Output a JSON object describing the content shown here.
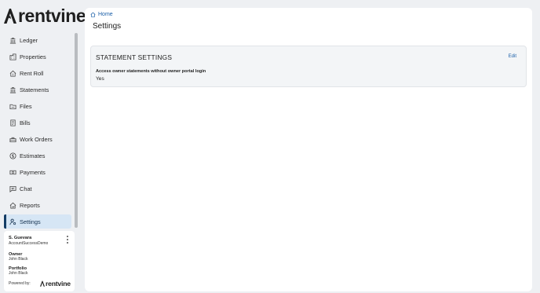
{
  "brand": {
    "name": "rentvine",
    "accent": "#143d66",
    "link_color": "#1a5fa8"
  },
  "sidebar": {
    "items": [
      {
        "label": "Ledger",
        "icon": "bank-icon",
        "active": false
      },
      {
        "label": "Properties",
        "icon": "building-icon",
        "active": false
      },
      {
        "label": "Rent Roll",
        "icon": "house-dollar-icon",
        "active": false
      },
      {
        "label": "Statements",
        "icon": "bank-icon",
        "active": false
      },
      {
        "label": "Files",
        "icon": "folder-icon",
        "active": false
      },
      {
        "label": "Bills",
        "icon": "receipt-icon",
        "active": false
      },
      {
        "label": "Work Orders",
        "icon": "toolbox-icon",
        "active": false
      },
      {
        "label": "Estimates",
        "icon": "dollar-circle-icon",
        "active": false
      },
      {
        "label": "Payments",
        "icon": "cash-icon",
        "active": false
      },
      {
        "label": "Chat",
        "icon": "chat-icon",
        "active": false
      },
      {
        "label": "Reports",
        "icon": "report-icon",
        "active": false
      },
      {
        "label": "Settings",
        "icon": "user-settings-icon",
        "active": true
      }
    ]
  },
  "user": {
    "name": "S. Guevara",
    "account": "AccountSuccessDemo",
    "owner_label": "Owner",
    "owner_value": "John Black",
    "portfolio_label": "Portfolio",
    "portfolio_value": "John Black",
    "powered_by": "Powered by:",
    "powered_logo": "rentvine"
  },
  "main": {
    "breadcrumb": "Home",
    "title": "Settings",
    "card": {
      "title": "STATEMENT SETTINGS",
      "edit_label": "Edit",
      "field_label": "Access owner statements without owner portal login",
      "field_value": "Yes"
    }
  }
}
